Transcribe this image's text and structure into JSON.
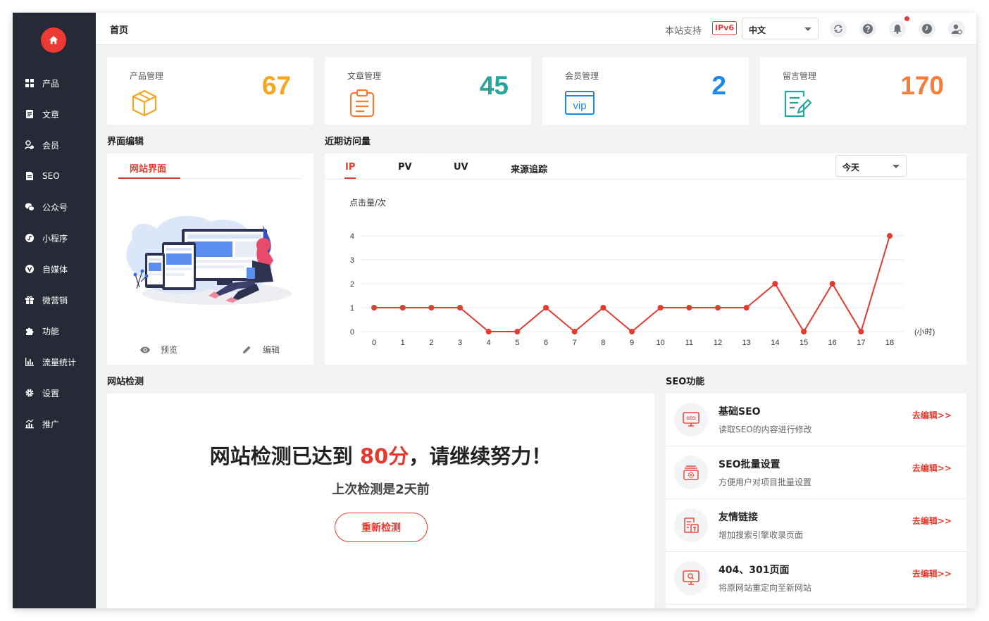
{
  "sidebar": {
    "logo_icon": "home-icon",
    "items": [
      {
        "label": "产品",
        "icon": "grid-icon"
      },
      {
        "label": "文章",
        "icon": "document-icon"
      },
      {
        "label": "会员",
        "icon": "users-icon"
      },
      {
        "label": "SEO",
        "icon": "file-icon"
      },
      {
        "label": "公众号",
        "icon": "wechat-icon"
      },
      {
        "label": "小程序",
        "icon": "miniprogram-icon"
      },
      {
        "label": "自媒体",
        "icon": "media-icon"
      },
      {
        "label": "微营销",
        "icon": "gift-icon"
      },
      {
        "label": "功能",
        "icon": "puzzle-icon"
      },
      {
        "label": "流量统计",
        "icon": "bar-chart-icon"
      },
      {
        "label": "设置",
        "icon": "gear-icon"
      },
      {
        "label": "推广",
        "icon": "promote-icon"
      }
    ]
  },
  "header": {
    "breadcrumb": "首页",
    "support_text": "本站支持",
    "ipv6_badge": "IPv6",
    "language": "中文"
  },
  "stats": [
    {
      "label": "产品管理",
      "value": "67",
      "color": "#f5a623",
      "icon": "box-icon"
    },
    {
      "label": "文章管理",
      "value": "45",
      "color": "#26a69a",
      "icon": "clipboard-icon"
    },
    {
      "label": "会员管理",
      "value": "2",
      "color": "#1e88e5",
      "icon": "vip-icon"
    },
    {
      "label": "留言管理",
      "value": "170",
      "color": "#f57c3a",
      "icon": "message-edit-icon"
    }
  ],
  "vip_text": "vip",
  "interface": {
    "section_title": "界面编辑",
    "tab": "网站界面",
    "preview": "预览",
    "edit": "编辑"
  },
  "visits": {
    "section_title": "近期访问量",
    "tabs": [
      "IP",
      "PV",
      "UV",
      "来源追踪"
    ],
    "active_tab": "IP",
    "date_range": "今天"
  },
  "chart_data": {
    "type": "line",
    "ylabel": "点击量/次",
    "xlabel": "(小时)",
    "x": [
      0,
      1,
      2,
      3,
      4,
      5,
      6,
      7,
      8,
      9,
      10,
      11,
      12,
      13,
      14,
      15,
      16,
      17,
      18
    ],
    "values": [
      1,
      1,
      1,
      1,
      0,
      0,
      1,
      0,
      1,
      0,
      1,
      1,
      1,
      1,
      2,
      0,
      2,
      0,
      4
    ],
    "yticks": [
      0,
      1,
      2,
      3,
      4
    ],
    "ylim": [
      0,
      4
    ],
    "grid": true,
    "color": "#e53a2f"
  },
  "detect": {
    "section_title": "网站检测",
    "headline_prefix": "网站检测已达到 ",
    "score": "80分",
    "headline_suffix": "，请继续努力！",
    "last_check": "上次检测是2天前",
    "button": "重新检测"
  },
  "seo": {
    "section_title": "SEO功能",
    "seo_badge": "SEO",
    "items": [
      {
        "title": "基础SEO",
        "desc": "读取SEO的内容进行修改",
        "link": "去编辑>>",
        "icon": "seo-monitor-icon"
      },
      {
        "title": "SEO批量设置",
        "desc": "方便用户对项目批量设置",
        "link": "去编辑>>",
        "icon": "batch-settings-icon"
      },
      {
        "title": "友情链接",
        "desc": "增加搜索引擎收录页面",
        "link": "去编辑>>",
        "icon": "link-document-icon"
      },
      {
        "title": "404、301页面",
        "desc": "将原网站重定向至新网站",
        "link": "去编辑>>",
        "icon": "redirect-screen-icon"
      }
    ]
  }
}
